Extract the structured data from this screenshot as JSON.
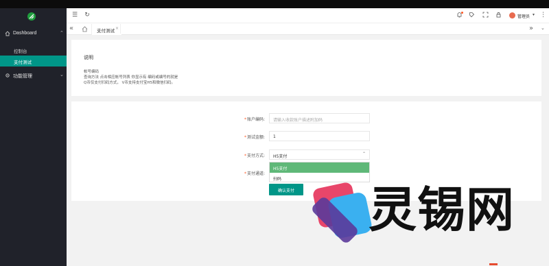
{
  "sidebar": {
    "groups": [
      {
        "label": "Dashboard",
        "icon": "home-icon",
        "items": [
          {
            "label": "控制台"
          },
          {
            "label": "支付测试",
            "active": true
          }
        ]
      },
      {
        "label": "功能管理",
        "icon": "gear-icon"
      }
    ]
  },
  "header": {
    "admin_name": "管理员",
    "icons": [
      "menu-toggle-icon",
      "refresh-icon",
      "notification-bell-icon",
      "theme-icon",
      "fullscreen-icon",
      "lock-icon",
      "more-icon"
    ]
  },
  "tabs": [
    {
      "label": "支付测试",
      "close": "×"
    }
  ],
  "info_card": {
    "title": "说明",
    "lines": [
      "帐号编码",
      "查询方法 点击相应帐号列表 你显示有 编码或编号的就是",
      "Q币仅支付扫码方式， V币支持支付宝H5和微信扫码。"
    ]
  },
  "form": {
    "account_label": "账户编码:",
    "account_placeholder": "请输入收款账户描述附加码",
    "amount_label": "测试金额:",
    "amount_value": "1",
    "method_label": "支付方式:",
    "method_value": "H5支付",
    "method_options": [
      "H5支付",
      "扫码"
    ],
    "channel_label": "支付通道:",
    "submit_label": "确认支付"
  },
  "watermark": {
    "text": "灵锡网",
    "colors": {
      "pink": "#e8466a",
      "blue": "#3ab0f0",
      "purple": "#5b3a9a"
    }
  },
  "colors": {
    "sidebar_bg": "#20222a",
    "accent": "#009688",
    "option_selected": "#5fb878",
    "required": "#ff5722"
  }
}
